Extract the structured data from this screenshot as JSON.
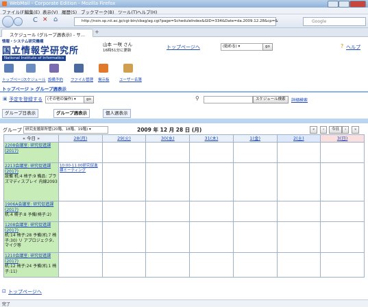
{
  "window": {
    "title": "WebMail - Corporate Edition - Mozilla Firefox"
  },
  "menu": [
    "ファイル(F)",
    "編集(E)",
    "表示(V)",
    "履歴(S)",
    "ブックマーク(B)",
    "ツール(T)",
    "ヘルプ(H)"
  ],
  "browser": {
    "url": "http://nsin.sp.nii.ac.jp/cgi-bin/cbag/ag.cgi?page=ScheduleIndex&GID=334&Date=da.2009.12.28&cp=&",
    "search_placeholder": "Google",
    "tab_title": "スケジュール (グループ週表示) - サ..."
  },
  "header": {
    "org_small": "情報・システム研究機構",
    "org_big": "国立情報学研究所",
    "org_en": "National Institute of Informatics",
    "user_name": "山本 一咲 さん",
    "user_time": "16時51分に更新",
    "top_link": "トップページへ",
    "start_select": "(始める)",
    "go": "go",
    "help_link": "ヘルプ"
  },
  "apps": [
    "トップページ",
    "スケジュール",
    "設備予約",
    "ファイル管理",
    "掲示板",
    "ユーザー名簿"
  ],
  "breadcrumb": "トップページ > グループ週表示",
  "toolbar": {
    "register": "予定を登録する",
    "other_ops": "(その他の操作)",
    "go": "go",
    "schedule_search": "スケジュール検索",
    "detail_search": "詳細検索"
  },
  "view_tabs": [
    "グループ日表示",
    "グループ週表示",
    "個人週表示"
  ],
  "group": {
    "label": "グループ",
    "value": "研究支援部所管(20階、18階、19階)",
    "date_title": "2009 年 12 月 28 日 (月)",
    "nav_buttons": [
      "«",
      "‹",
      "今日",
      "›",
      "»"
    ]
  },
  "calendar": {
    "today_btn": "今日",
    "days": [
      {
        "label": "28(月)",
        "kind": "weekday"
      },
      {
        "label": "29(火)",
        "kind": "weekday"
      },
      {
        "label": "30(水)",
        "kind": "weekday"
      },
      {
        "label": "31(木)",
        "kind": "weekday"
      },
      {
        "label": "1(金)",
        "kind": "weekday"
      },
      {
        "label": "2(土)",
        "kind": "sat"
      },
      {
        "label": "3(日)",
        "kind": "sun"
      }
    ],
    "rows": [
      {
        "facility": "2208会議室: 研究促進課(2017)",
        "detail": "",
        "events": [
          "",
          "",
          "",
          "",
          "",
          "",
          ""
        ]
      },
      {
        "facility": "2213会議室: 研究促進課(2017)",
        "detail": "設備 机:4 椅子:9 備品: プラズマディスプレイ 内線2093",
        "events": [
          "10:00-11:00研究促進課ミーティング",
          "",
          "",
          "",
          "",
          "",
          ""
        ]
      },
      {
        "facility": "1906A会議室: 研究促進課(2017)",
        "detail": "机:4 椅子:8 予備(椅子:2)",
        "events": [
          "",
          "",
          "",
          "",
          "",
          "",
          ""
        ]
      },
      {
        "facility": "1208会議室: 研究促進課(2017)",
        "detail": "机:14 椅子:28 予備(机:7 椅子:30) リ アプロジェクタ、マイク等",
        "events": [
          "",
          "",
          "",
          "",
          "",
          "",
          ""
        ]
      },
      {
        "facility": "1210会議室: 研究促進課(2017)",
        "detail": "机:12 椅子:24 予備(机:1 椅子:11)",
        "events": [
          "",
          "",
          "",
          "",
          "",
          "",
          ""
        ]
      }
    ]
  },
  "footer": {
    "top_link": "トップページへ",
    "status": "完了"
  }
}
